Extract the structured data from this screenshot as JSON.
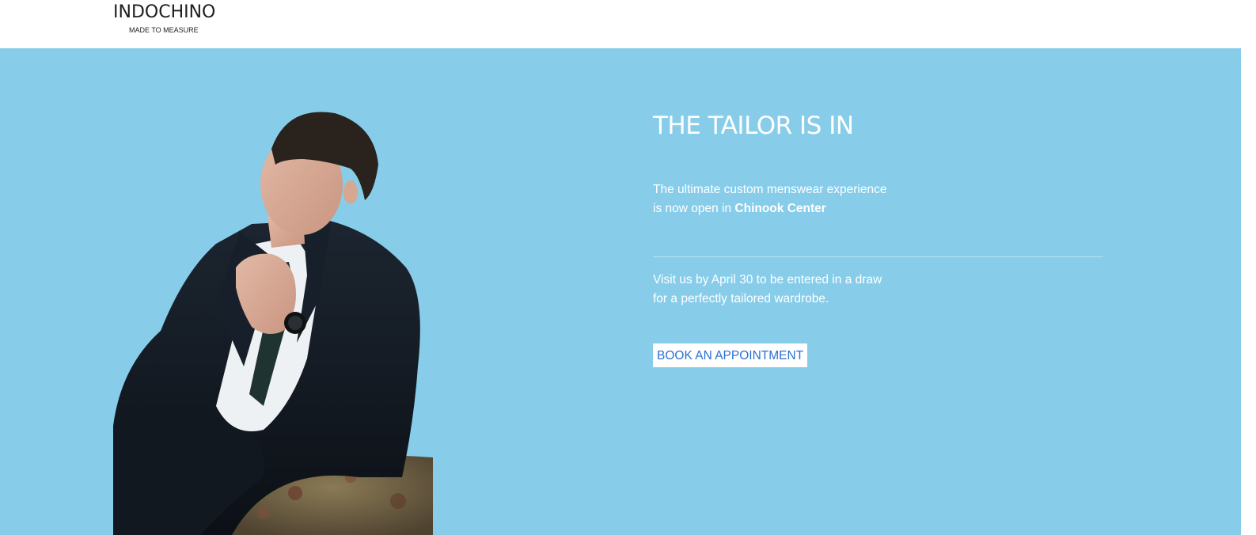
{
  "header": {
    "logo_name": "INDOCHINO",
    "logo_tagline": "MADE TO MEASURE"
  },
  "hero": {
    "background_color": "#87cdea",
    "headline": "THE TAILOR IS IN",
    "intro_line1": "The ultimate custom menswear experience",
    "intro_line2_prefix": "is now open in ",
    "intro_location": "Chinook Center",
    "visit_line1": "Visit us by April 30 to be entered in a draw",
    "visit_line2": "for a perfectly tailored wardrobe.",
    "cta_label": "BOOK AN APPOINTMENT",
    "cta_text_color": "#2a6fd6",
    "image": "man-in-suit-seated-photo"
  }
}
